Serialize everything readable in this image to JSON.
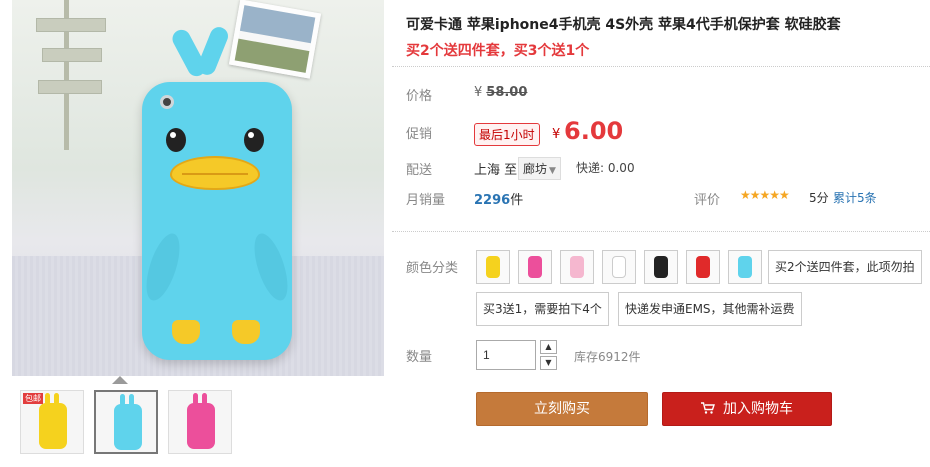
{
  "product": {
    "title": "可爱卡通 苹果iphone4手机壳 4S外壳 苹果4代手机保护套 软硅胶套",
    "subtitle": "买2个送四件套，买3个送1个"
  },
  "pricing": {
    "price_label": "价格",
    "currency": "¥",
    "original_price": "58.00",
    "promo_label": "促销",
    "promo_tag": "最后1小时",
    "promo_price": "6.00"
  },
  "shipping": {
    "label": "配送",
    "from": "上海",
    "to_prefix": "至",
    "destination": "廊坊",
    "fee": "快递: 0.00"
  },
  "stats": {
    "monthly_label": "月销量",
    "monthly_sales": "2296",
    "unit": "件",
    "review_label": "评价",
    "stars": "★★★★★",
    "rating": 5,
    "score": "5分",
    "review_count": "累计5条"
  },
  "sku": {
    "color_label": "颜色分类",
    "swatch_colors": [
      "#f5d21e",
      "#ec4f9b",
      "#f5b7cf",
      "#ffffff",
      "#222222",
      "#e02a2a",
      "#5fd3ec"
    ],
    "text_options": [
      "买2个送四件套，此项勿拍",
      "买3送1，需要拍下4个",
      "快递发申通EMS，其他需补运费"
    ]
  },
  "quantity": {
    "label": "数量",
    "value": "1",
    "stock": "库存6912件"
  },
  "actions": {
    "buy_now": "立刻购买",
    "add_to_cart": "加入购物车"
  },
  "gallery": {
    "thumb_tag": "包邮",
    "active_index": 1,
    "thumb_colors": [
      "#f5d21e",
      "#5fd3ec",
      "#ec4f9b"
    ]
  },
  "colors": {
    "accent_red": "#e4393c",
    "buy_button": "#c57a3b",
    "cart_button": "#c9201c",
    "link_blue": "#2a74b3"
  }
}
